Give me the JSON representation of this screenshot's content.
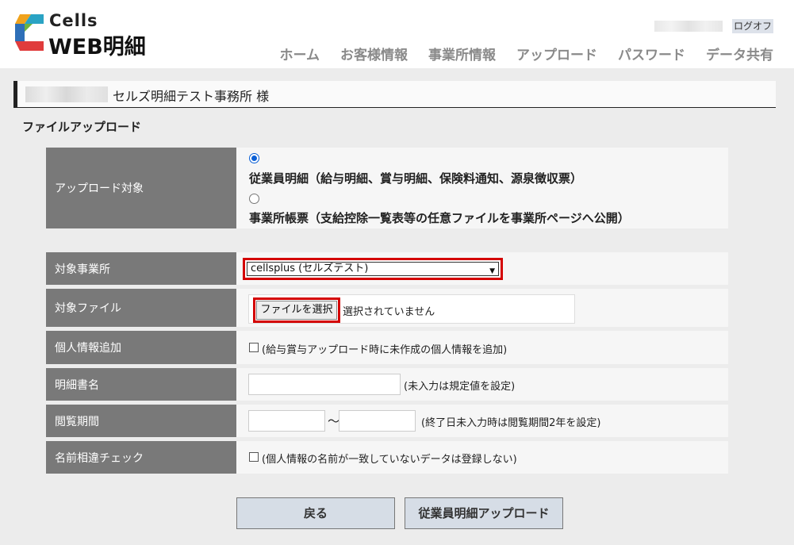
{
  "header": {
    "logo_top": "Cells",
    "logo_bottom": "WEB明細",
    "logoff_label": "ログオフ",
    "nav": [
      "ホーム",
      "お客様情報",
      "事業所情報",
      "アップロード",
      "パスワード",
      "データ共有"
    ]
  },
  "title_bar": {
    "text": "セルズ明細テスト事務所 様"
  },
  "section_title": "ファイルアップロード",
  "form": {
    "upload_target": {
      "label": "アップロード対象",
      "options": [
        {
          "text": "従業員明細（給与明細、賞与明細、保険料通知、源泉徴収票）",
          "checked": true
        },
        {
          "text": "事業所帳票（支給控除一覧表等の任意ファイルを事業所ページへ公開）",
          "checked": false
        }
      ]
    },
    "office": {
      "label": "対象事業所",
      "selected": "cellsplus (セルズテスト)"
    },
    "file": {
      "label": "対象ファイル",
      "button": "ファイルを選択",
      "status": "選択されていません"
    },
    "personal_info": {
      "label": "個人情報追加",
      "note": "(給与賞与アップロード時に未作成の個人情報を追加)",
      "checked": false
    },
    "statement_name": {
      "label": "明細書名",
      "value": "",
      "note": "(未入力は規定値を設定)"
    },
    "viewing_period": {
      "label": "閲覧期間",
      "start": "",
      "end": "",
      "separator": "〜",
      "note": "(終了日未入力時は閲覧期間2年を設定)"
    },
    "name_check": {
      "label": "名前相違チェック",
      "note": "(個人情報の名前が一致していないデータは登録しない)",
      "checked": false
    }
  },
  "buttons": {
    "back": "戻る",
    "upload": "従業員明細アップロード"
  },
  "colors": {
    "highlight": "#d40000",
    "label_bg": "#797979",
    "radio_accent": "#0a5fd6",
    "button_bg": "#d6dde6"
  }
}
